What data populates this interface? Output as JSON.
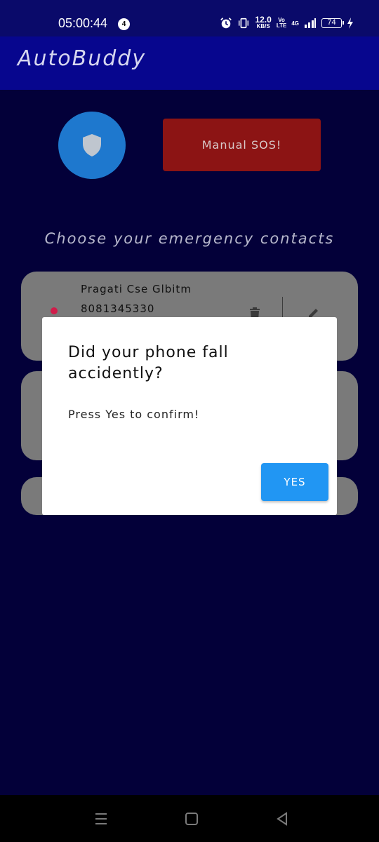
{
  "status_bar": {
    "time": "05:00:44",
    "notification_count": "4",
    "net_speed_value": "12.0",
    "net_speed_unit": "KB/S",
    "volte_top": "Vo",
    "volte_bottom": "LTE",
    "network": "4G",
    "battery": "74"
  },
  "app_bar": {
    "title": "AutoBuddy"
  },
  "controls": {
    "shield_icon": "shield-icon",
    "sos_label": "Manual SOS!"
  },
  "contacts_heading": "Choose your emergency contacts",
  "contacts": [
    {
      "name": "Pragati Cse Glbitm",
      "phone": "8081345330"
    }
  ],
  "dialog": {
    "title": "Did your phone fall accidently?",
    "message": "Press Yes to confirm!",
    "confirm_label": "YES"
  },
  "colors": {
    "background": "#030039",
    "app_bar": "#07068e",
    "shield_button": "#1e78ce",
    "sos_button": "#8c1414",
    "card": "#7a7a7a",
    "dialog_button": "#2196f3",
    "dot": "#d01c4a"
  }
}
